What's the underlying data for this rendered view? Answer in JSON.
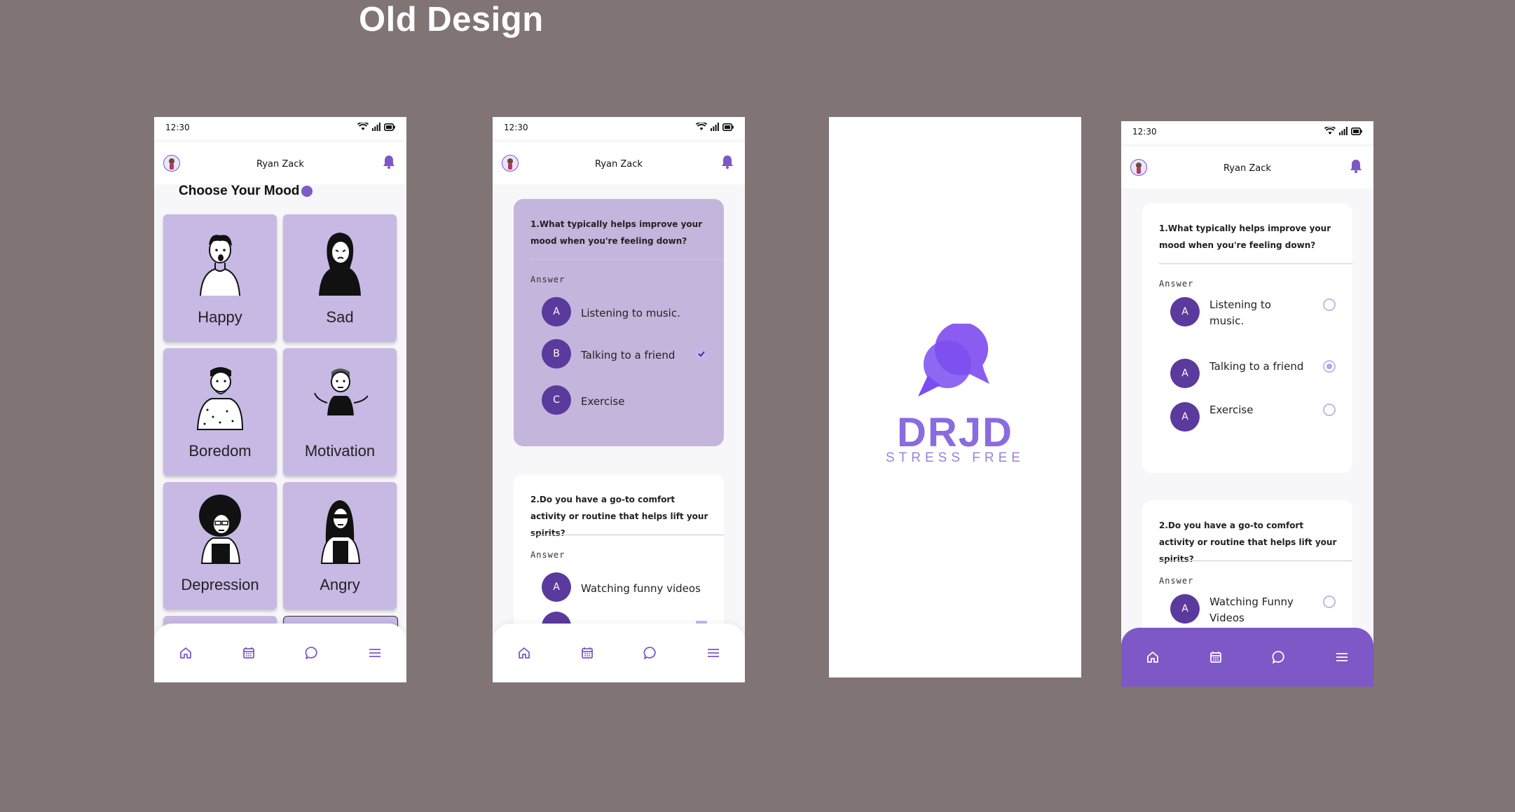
{
  "page": {
    "title": "Old Design"
  },
  "status": {
    "time": "12:30"
  },
  "user": {
    "name": "Ryan Zack"
  },
  "colors": {
    "background": "#807474",
    "accent": "#7d58c6",
    "card": "#c8b8e4",
    "option_circle": "#5b3a9d"
  },
  "mood_screen": {
    "title": "Choose Your Mood",
    "moods": [
      {
        "label": "Happy"
      },
      {
        "label": "Sad"
      },
      {
        "label": "Boredom"
      },
      {
        "label": "Motivation"
      },
      {
        "label": "Depression"
      },
      {
        "label": "Angry"
      }
    ]
  },
  "quiz_screen_1": {
    "q1": {
      "question": "1.What typically helps improve your mood when you're feeling down?",
      "answer_label": "Answer",
      "options": [
        {
          "letter": "A",
          "text": "Listening to music.",
          "checked": false
        },
        {
          "letter": "B",
          "text": "Talking to a friend",
          "checked": true
        },
        {
          "letter": "C",
          "text": "Exercise",
          "checked": false
        }
      ]
    },
    "q2": {
      "question": "2.Do you have a go-to comfort activity or routine that helps lift your spirits?",
      "answer_label": "Answer",
      "options": [
        {
          "letter": "A",
          "text": "Watching funny videos"
        }
      ]
    }
  },
  "splash": {
    "brand": "DRJD",
    "tagline": "STRESS FREE"
  },
  "quiz_screen_2": {
    "q1": {
      "question": "1.What typically helps improve your mood when you're feeling down?",
      "answer_label": "Answer",
      "options": [
        {
          "letter": "A",
          "text": "Listening to music.",
          "selected": false
        },
        {
          "letter": "A",
          "text": "Talking to a friend",
          "selected": true
        },
        {
          "letter": "A",
          "text": "Exercise",
          "selected": false
        }
      ]
    },
    "q2": {
      "question": "2.Do you have a go-to comfort activity or routine that helps lift your spirits?",
      "answer_label": "Answer",
      "options": [
        {
          "letter": "A",
          "text": "Watching Funny Videos",
          "selected": false
        }
      ]
    }
  },
  "nav": {
    "items": [
      {
        "icon": "home-icon"
      },
      {
        "icon": "calendar-icon"
      },
      {
        "icon": "chat-icon"
      },
      {
        "icon": "menu-icon"
      }
    ]
  }
}
